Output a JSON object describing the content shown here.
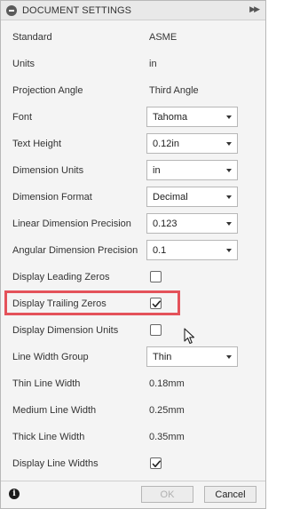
{
  "panel": {
    "title": "DOCUMENT SETTINGS"
  },
  "rows": [
    {
      "label": "Standard",
      "type": "text",
      "value": "ASME"
    },
    {
      "label": "Units",
      "type": "text",
      "value": "in"
    },
    {
      "label": "Projection Angle",
      "type": "text",
      "value": "Third Angle"
    },
    {
      "label": "Font",
      "type": "select",
      "value": "Tahoma"
    },
    {
      "label": "Text Height",
      "type": "select",
      "value": "0.12in"
    },
    {
      "label": "Dimension Units",
      "type": "select",
      "value": "in"
    },
    {
      "label": "Dimension Format",
      "type": "select",
      "value": "Decimal"
    },
    {
      "label": "Linear Dimension Precision",
      "type": "select",
      "value": "0.123"
    },
    {
      "label": "Angular Dimension Precision",
      "type": "select",
      "value": "0.1"
    },
    {
      "label": "Display Leading Zeros",
      "type": "checkbox",
      "checked": false
    },
    {
      "label": "Display Trailing Zeros",
      "type": "checkbox",
      "checked": true,
      "highlighted": true
    },
    {
      "label": "Display Dimension Units",
      "type": "checkbox",
      "checked": false
    },
    {
      "label": "Line Width Group",
      "type": "select",
      "value": "Thin"
    },
    {
      "label": "Thin Line Width",
      "type": "text",
      "value": "0.18mm"
    },
    {
      "label": "Medium Line Width",
      "type": "text",
      "value": "0.25mm"
    },
    {
      "label": "Thick Line Width",
      "type": "text",
      "value": "0.35mm"
    },
    {
      "label": "Display Line Widths",
      "type": "checkbox",
      "checked": true
    }
  ],
  "footer": {
    "info_icon": "info-icon",
    "ok_label": "OK",
    "cancel_label": "Cancel"
  },
  "colors": {
    "highlight": "#e4525a",
    "panel_bg": "#f4f4f4"
  }
}
